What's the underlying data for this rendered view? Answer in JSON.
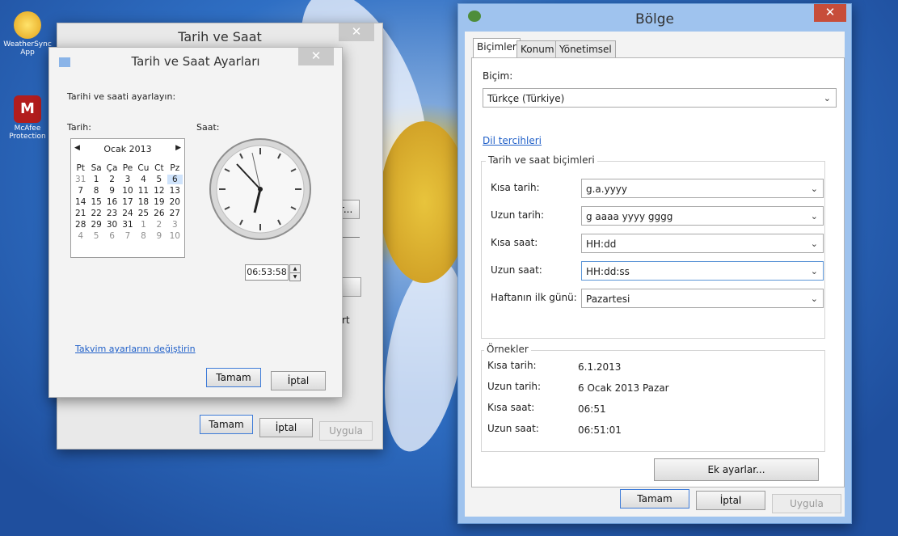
{
  "desktop": {
    "icons": [
      {
        "label": "WeatherSync App"
      },
      {
        "label": "McAfee Protection"
      }
    ]
  },
  "outer_dialog": {
    "title": "Tarih ve Saat",
    "buttons": {
      "ok": "Tamam",
      "cancel": "İptal",
      "apply": "Uygula"
    },
    "partial_button_1": "ir...",
    "partial_text": "rt"
  },
  "date_time_dialog": {
    "title": "Tarih ve Saat Ayarları",
    "instruction": "Tarihi ve saati ayarlayın:",
    "date_label": "Tarih:",
    "time_label": "Saat:",
    "calendar": {
      "month_label": "Ocak 2013",
      "day_headers": [
        "Pt",
        "Sa",
        "Ça",
        "Pe",
        "Cu",
        "Ct",
        "Pz"
      ],
      "days": [
        [
          "31",
          "1",
          "2",
          "3",
          "4",
          "5",
          "6"
        ],
        [
          "7",
          "8",
          "9",
          "10",
          "11",
          "12",
          "13"
        ],
        [
          "14",
          "15",
          "16",
          "17",
          "18",
          "19",
          "20"
        ],
        [
          "21",
          "22",
          "23",
          "24",
          "25",
          "26",
          "27"
        ],
        [
          "28",
          "29",
          "30",
          "31",
          "1",
          "2",
          "3"
        ],
        [
          "4",
          "5",
          "6",
          "7",
          "8",
          "9",
          "10"
        ]
      ]
    },
    "time_value": "06:53:58",
    "calendar_link": "Takvim ayarlarını değiştirin",
    "buttons": {
      "ok": "Tamam",
      "cancel": "İptal"
    }
  },
  "region_dialog": {
    "title": "Bölge",
    "tabs": [
      "Biçimler",
      "Konum",
      "Yönetimsel"
    ],
    "format_label": "Biçim:",
    "format_value": "Türkçe (Türkiye)",
    "language_link": "Dil tercihleri",
    "formats_group_title": "Tarih ve saat biçimleri",
    "fields": [
      {
        "label": "Kısa tarih:",
        "value": "g.a.yyyy"
      },
      {
        "label": "Uzun tarih:",
        "value": "g aaaa yyyy gggg"
      },
      {
        "label": "Kısa saat:",
        "value": "HH:dd"
      },
      {
        "label": "Uzun saat:",
        "value": "HH:dd:ss"
      },
      {
        "label": "Haftanın ilk günü:",
        "value": "Pazartesi"
      }
    ],
    "examples_group_title": "Örnekler",
    "examples": [
      {
        "label": "Kısa tarih:",
        "value": "6.1.2013"
      },
      {
        "label": "Uzun tarih:",
        "value": "6 Ocak 2013 Pazar"
      },
      {
        "label": "Kısa saat:",
        "value": "06:51"
      },
      {
        "label": "Uzun saat:",
        "value": "06:51:01"
      }
    ],
    "additional_button": "Ek ayarlar...",
    "buttons": {
      "ok": "Tamam",
      "cancel": "İptal",
      "apply": "Uygula"
    }
  }
}
